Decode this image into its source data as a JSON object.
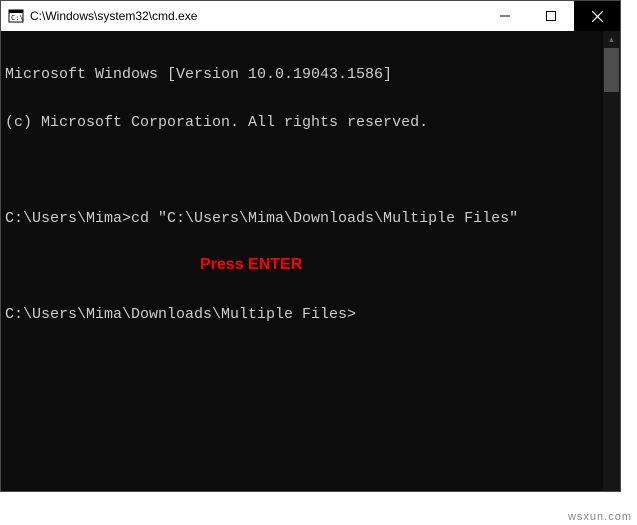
{
  "title": "C:\\Windows\\system32\\cmd.exe",
  "terminal": {
    "line1": "Microsoft Windows [Version 10.0.19043.1586]",
    "line2": "(c) Microsoft Corporation. All rights reserved.",
    "line3": "",
    "line4": "C:\\Users\\Mima>cd \"C:\\Users\\Mima\\Downloads\\Multiple Files\"",
    "line5": "",
    "line6": "C:\\Users\\Mima\\Downloads\\Multiple Files>"
  },
  "annotation": "Press ENTER",
  "watermark": "wsxun.com"
}
